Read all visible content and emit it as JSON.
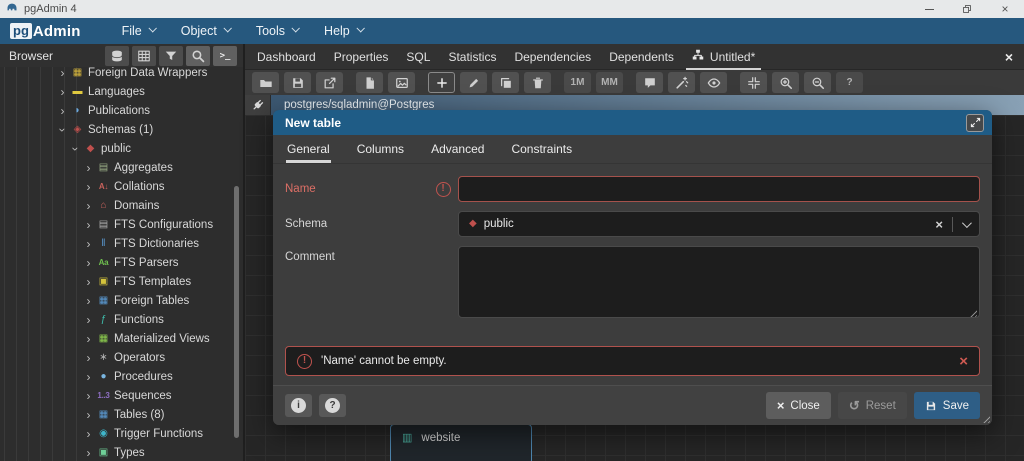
{
  "window": {
    "title": "pgAdmin 4"
  },
  "menubar": {
    "logo_pg": "pg",
    "logo_admin": "Admin",
    "menus": [
      "File",
      "Object",
      "Tools",
      "Help"
    ]
  },
  "browser": {
    "title": "Browser",
    "buttons": [
      {
        "name": "servers-icon",
        "highlight": false
      },
      {
        "name": "grid-icon",
        "highlight": false
      },
      {
        "name": "filter-icon",
        "highlight": false
      },
      {
        "name": "search-icon",
        "highlight": true
      },
      {
        "name": "terminal-icon",
        "highlight": true
      }
    ]
  },
  "tree": {
    "items": [
      {
        "label": "Foreign Data Wrappers",
        "depth": 0,
        "state": "collapsed",
        "icon": "foreign-data-wrappers-icon",
        "glyph": "▦",
        "color": "#d4b43c"
      },
      {
        "label": "Languages",
        "depth": 0,
        "state": "collapsed",
        "icon": "languages-icon",
        "glyph": "▬",
        "color": "#e0c93f"
      },
      {
        "label": "Publications",
        "depth": 0,
        "state": "collapsed",
        "icon": "publications-icon",
        "glyph": "◗",
        "color": "#6aa7dc"
      },
      {
        "label": "Schemas (1)",
        "depth": 0,
        "state": "expanded",
        "icon": "schemas-icon",
        "glyph": "◈",
        "color": "#c0504d"
      },
      {
        "label": "public",
        "depth": 1,
        "state": "expanded",
        "icon": "schema-public-icon",
        "glyph": "◆",
        "color": "#c0504d"
      },
      {
        "label": "Aggregates",
        "depth": 2,
        "state": "collapsed",
        "icon": "aggregates-icon",
        "glyph": "▤",
        "color": "#9caf88"
      },
      {
        "label": "Collations",
        "depth": 2,
        "state": "collapsed",
        "icon": "collations-icon",
        "glyph": "A↓",
        "color": "#c9625c",
        "text_icon": true
      },
      {
        "label": "Domains",
        "depth": 2,
        "state": "collapsed",
        "icon": "domains-icon",
        "glyph": "⌂",
        "color": "#c9625c"
      },
      {
        "label": "FTS Configurations",
        "depth": 2,
        "state": "collapsed",
        "icon": "fts-configurations-icon",
        "glyph": "▤",
        "color": "#b0b0b0"
      },
      {
        "label": "FTS Dictionaries",
        "depth": 2,
        "state": "collapsed",
        "icon": "fts-dictionaries-icon",
        "glyph": "‖",
        "color": "#5b9bd5"
      },
      {
        "label": "FTS Parsers",
        "depth": 2,
        "state": "collapsed",
        "icon": "fts-parsers-icon",
        "glyph": "Aa",
        "color": "#6fbf4f",
        "text_icon": true
      },
      {
        "label": "FTS Templates",
        "depth": 2,
        "state": "collapsed",
        "icon": "fts-templates-icon",
        "glyph": "▣",
        "color": "#d4c33c"
      },
      {
        "label": "Foreign Tables",
        "depth": 2,
        "state": "collapsed",
        "icon": "foreign-tables-icon",
        "glyph": "▦",
        "color": "#5b9bd5"
      },
      {
        "label": "Functions",
        "depth": 2,
        "state": "collapsed",
        "icon": "functions-icon",
        "glyph": "ƒ",
        "color": "#3fbfae"
      },
      {
        "label": "Materialized Views",
        "depth": 2,
        "state": "collapsed",
        "icon": "materialized-views-icon",
        "glyph": "▦",
        "color": "#8fd14f"
      },
      {
        "label": "Operators",
        "depth": 2,
        "state": "collapsed",
        "icon": "operators-icon",
        "glyph": "∗",
        "color": "#b0b0b0"
      },
      {
        "label": "Procedures",
        "depth": 2,
        "state": "collapsed",
        "icon": "procedures-icon",
        "glyph": "●",
        "color": "#7ab6e0"
      },
      {
        "label": "Sequences",
        "depth": 2,
        "state": "collapsed",
        "icon": "sequences-icon",
        "glyph": "1..3",
        "color": "#8f6fc4",
        "text_icon": true
      },
      {
        "label": "Tables (8)",
        "depth": 2,
        "state": "collapsed",
        "icon": "tables-icon",
        "glyph": "▦",
        "color": "#5b9bd5"
      },
      {
        "label": "Trigger Functions",
        "depth": 2,
        "state": "collapsed",
        "icon": "trigger-functions-icon",
        "glyph": "◉",
        "color": "#3fb5c9"
      },
      {
        "label": "Types",
        "depth": 2,
        "state": "collapsed",
        "icon": "types-icon",
        "glyph": "▣",
        "color": "#6fcf97"
      }
    ]
  },
  "main": {
    "tabs": [
      {
        "label": "Dashboard"
      },
      {
        "label": "Properties"
      },
      {
        "label": "SQL"
      },
      {
        "label": "Statistics"
      },
      {
        "label": "Dependencies"
      },
      {
        "label": "Dependents"
      },
      {
        "label": "Untitled*",
        "active": true,
        "icon": "sitemap-icon"
      }
    ],
    "toolbar": [
      {
        "name": "open-file-button",
        "icon": "folder"
      },
      {
        "name": "save-file-button",
        "icon": "floppy"
      },
      {
        "name": "save-as-button",
        "icon": "share"
      },
      {
        "name": "generate-sql-button",
        "icon": "sqlfile",
        "gap": true
      },
      {
        "name": "download-image-button",
        "icon": "imgfile"
      },
      {
        "name": "add-table-button",
        "icon": "plus",
        "variant": "dark",
        "gap": true
      },
      {
        "name": "edit-table-button",
        "icon": "pencil"
      },
      {
        "name": "clone-table-button",
        "icon": "copy"
      },
      {
        "name": "drop-table-button",
        "icon": "trash"
      },
      {
        "name": "one-to-many-button",
        "label": "1M",
        "gap": true
      },
      {
        "name": "many-to-many-button",
        "label": "MM"
      },
      {
        "name": "add-note-button",
        "icon": "note",
        "gap": true
      },
      {
        "name": "auto-align-button",
        "icon": "wand"
      },
      {
        "name": "show-details-button",
        "icon": "eye"
      },
      {
        "name": "zoom-to-fit-button",
        "icon": "fit",
        "gap": true
      },
      {
        "name": "zoom-in-button",
        "icon": "zoomin"
      },
      {
        "name": "zoom-out-button",
        "icon": "zoomout"
      },
      {
        "name": "help-button",
        "label": "?"
      }
    ],
    "connection": "postgres/sqladmin@Postgres",
    "canvas_node": {
      "label": "website"
    }
  },
  "dialog": {
    "title": "New table",
    "tabs": [
      {
        "label": "General",
        "active": true
      },
      {
        "label": "Columns"
      },
      {
        "label": "Advanced"
      },
      {
        "label": "Constraints"
      }
    ],
    "fields": {
      "name_label": "Name",
      "name_value": "",
      "schema_label": "Schema",
      "schema_value": "public",
      "comment_label": "Comment",
      "comment_value": ""
    },
    "error": "'Name' cannot be empty.",
    "footer": {
      "close_label": "Close",
      "reset_label": "Reset",
      "save_label": "Save"
    }
  },
  "colors": {
    "brand_blue": "#26587e",
    "dialog_header_blue": "#1f5c86",
    "error_red": "#c0534e",
    "save_blue": "#2e5e86"
  }
}
